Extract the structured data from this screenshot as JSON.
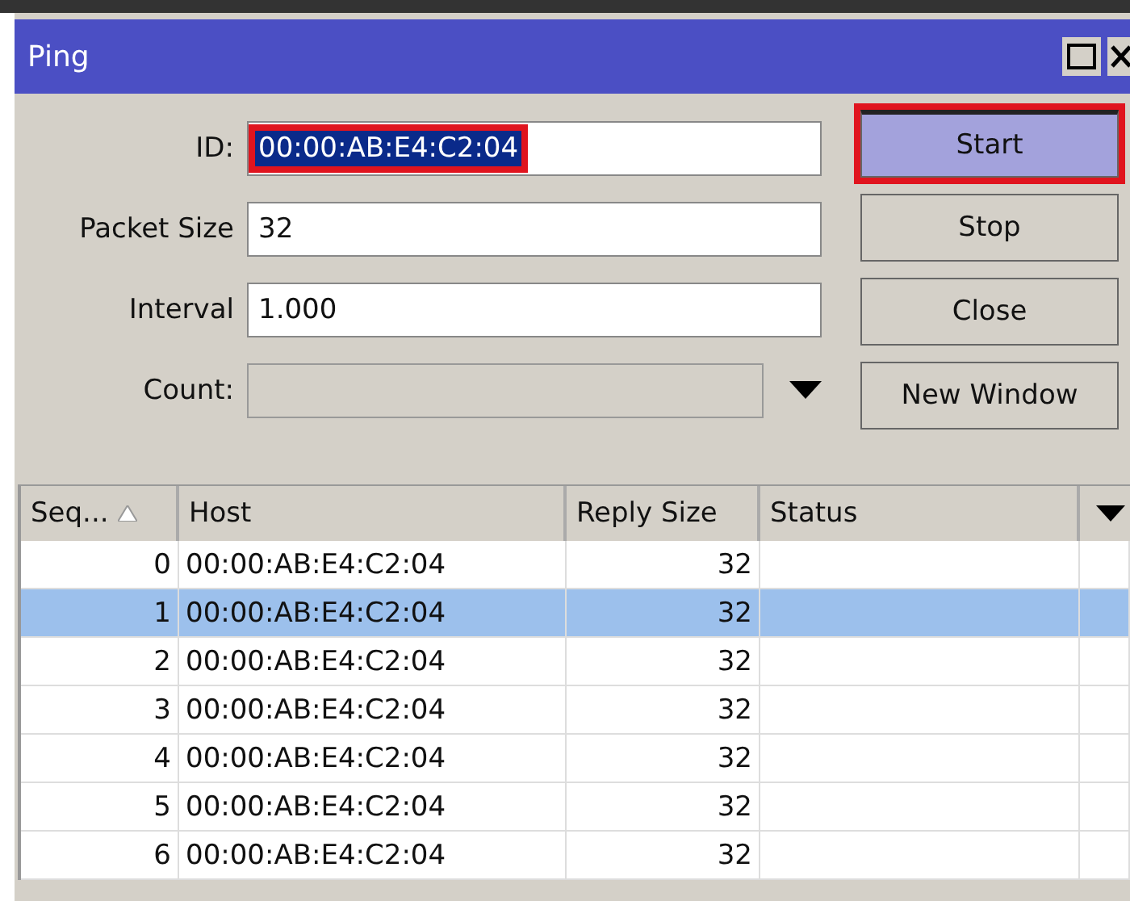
{
  "window": {
    "title": "Ping"
  },
  "fields": [
    {
      "label": "ID:",
      "value": "00:00:AB:E4:C2:04",
      "kind": "text",
      "highlighted": true,
      "text_selected": true
    },
    {
      "label": "Packet Size",
      "value": "32",
      "kind": "text",
      "highlighted": false,
      "text_selected": false
    },
    {
      "label": "Interval",
      "value": "1.000",
      "kind": "text",
      "highlighted": false,
      "text_selected": false
    },
    {
      "label": "Count:",
      "kind": "dropdown"
    }
  ],
  "buttons": [
    {
      "label": "Start",
      "highlighted": true,
      "pressed": true
    },
    {
      "label": "Stop",
      "highlighted": false,
      "pressed": false
    },
    {
      "label": "Close",
      "highlighted": false,
      "pressed": false
    },
    {
      "label": "New Window",
      "highlighted": false,
      "pressed": false
    }
  ],
  "table": {
    "columns": [
      "Seq...",
      "Host",
      "Reply Size",
      "Status"
    ],
    "rows": [
      {
        "seq": "0",
        "host": "00:00:AB:E4:C2:04",
        "reply_size": "32",
        "selected": false
      },
      {
        "seq": "1",
        "host": "00:00:AB:E4:C2:04",
        "reply_size": "32",
        "selected": true
      },
      {
        "seq": "2",
        "host": "00:00:AB:E4:C2:04",
        "reply_size": "32",
        "selected": false
      },
      {
        "seq": "3",
        "host": "00:00:AB:E4:C2:04",
        "reply_size": "32",
        "selected": false
      },
      {
        "seq": "4",
        "host": "00:00:AB:E4:C2:04",
        "reply_size": "32",
        "selected": false
      },
      {
        "seq": "5",
        "host": "00:00:AB:E4:C2:04",
        "reply_size": "32",
        "selected": false
      },
      {
        "seq": "6",
        "host": "00:00:AB:E4:C2:04",
        "reply_size": "32",
        "selected": false
      }
    ]
  }
}
